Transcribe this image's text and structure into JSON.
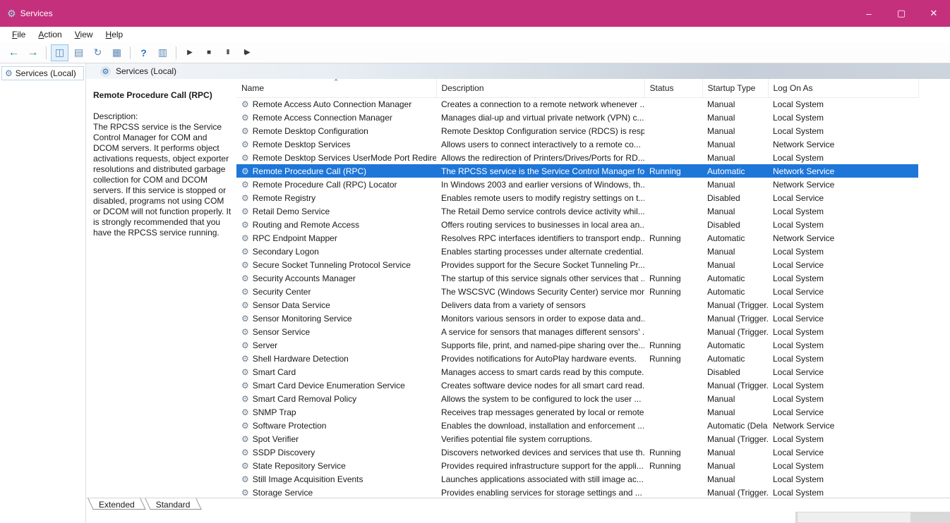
{
  "window": {
    "title": "Services",
    "controls": [
      {
        "name": "minimize",
        "glyph": "–"
      },
      {
        "name": "maximize",
        "glyph": "▢"
      },
      {
        "name": "close",
        "glyph": "✕"
      }
    ]
  },
  "menu": {
    "items": [
      "File",
      "Action",
      "View",
      "Help"
    ]
  },
  "toolbar": {
    "buttons": [
      {
        "name": "back-button",
        "glyph": "←",
        "style": "nav"
      },
      {
        "name": "forward-button",
        "glyph": "→",
        "style": "nav"
      },
      {
        "type": "sep"
      },
      {
        "name": "show-console-tree-button",
        "glyph": "◫",
        "style": "doc",
        "pressed": true
      },
      {
        "name": "properties-button",
        "glyph": "▤",
        "style": "doc"
      },
      {
        "name": "refresh-button",
        "glyph": "↻",
        "style": "doc"
      },
      {
        "name": "export-list-button",
        "glyph": "▦",
        "style": "doc"
      },
      {
        "type": "sep"
      },
      {
        "name": "help-button",
        "glyph": "?",
        "style": "help"
      },
      {
        "name": "show-action-pane-button",
        "glyph": "▥",
        "style": "doc"
      },
      {
        "type": "sep"
      },
      {
        "name": "start-service-button",
        "glyph": "▶",
        "style": "media"
      },
      {
        "name": "stop-service-button",
        "glyph": "■",
        "style": "media"
      },
      {
        "name": "pause-service-button",
        "glyph": "II",
        "style": "media"
      },
      {
        "name": "restart-service-button",
        "glyph": "I▶",
        "style": "media"
      }
    ]
  },
  "tree": {
    "root_label": "Services (Local)"
  },
  "icons": {
    "app": "⚙",
    "tree": "⚙",
    "header": "⚙",
    "service_gear": "⚙"
  },
  "colors": {
    "titlebar": "#c5307d",
    "selection": "#1e76d8"
  },
  "main": {
    "header_title": "Services (Local)",
    "detail": {
      "title": "Remote Procedure Call (RPC)",
      "description_label": "Description:",
      "description_text": "The RPCSS service is the Service Control Manager for COM and DCOM servers. It performs object activations requests, object exporter resolutions and distributed garbage collection for COM and DCOM servers. If this service is stopped or disabled, programs not using COM or DCOM will not function properly. It is strongly recommended that you have the RPCSS service running."
    },
    "table": {
      "columns": [
        "Name",
        "Description",
        "Status",
        "Startup Type",
        "Log On As"
      ],
      "sort_indicator": "^",
      "rows": [
        {
          "name": "Remote Access Auto Connection Manager",
          "description": "Creates a connection to a remote network whenever ...",
          "status": "",
          "startup": "Manual",
          "logon": "Local System",
          "selected": false
        },
        {
          "name": "Remote Access Connection Manager",
          "description": "Manages dial-up and virtual private network (VPN) c...",
          "status": "",
          "startup": "Manual",
          "logon": "Local System",
          "selected": false
        },
        {
          "name": "Remote Desktop Configuration",
          "description": "Remote Desktop Configuration service (RDCS) is resp...",
          "status": "",
          "startup": "Manual",
          "logon": "Local System",
          "selected": false
        },
        {
          "name": "Remote Desktop Services",
          "description": "Allows users to connect interactively to a remote co...",
          "status": "",
          "startup": "Manual",
          "logon": "Network Service",
          "selected": false
        },
        {
          "name": "Remote Desktop Services UserMode Port Redire...",
          "description": "Allows the redirection of Printers/Drives/Ports for RD...",
          "status": "",
          "startup": "Manual",
          "logon": "Local System",
          "selected": false
        },
        {
          "name": "Remote Procedure Call (RPC)",
          "description": "The RPCSS service is the Service Control Manager for...",
          "status": "Running",
          "startup": "Automatic",
          "logon": "Network Service",
          "selected": true
        },
        {
          "name": "Remote Procedure Call (RPC) Locator",
          "description": "In Windows 2003 and earlier versions of Windows, th...",
          "status": "",
          "startup": "Manual",
          "logon": "Network Service",
          "selected": false
        },
        {
          "name": "Remote Registry",
          "description": "Enables remote users to modify registry settings on t...",
          "status": "",
          "startup": "Disabled",
          "logon": "Local Service",
          "selected": false
        },
        {
          "name": "Retail Demo Service",
          "description": "The Retail Demo service controls device activity whil...",
          "status": "",
          "startup": "Manual",
          "logon": "Local System",
          "selected": false
        },
        {
          "name": "Routing and Remote Access",
          "description": "Offers routing services to businesses in local area an...",
          "status": "",
          "startup": "Disabled",
          "logon": "Local System",
          "selected": false
        },
        {
          "name": "RPC Endpoint Mapper",
          "description": "Resolves RPC interfaces identifiers to transport endp...",
          "status": "Running",
          "startup": "Automatic",
          "logon": "Network Service",
          "selected": false
        },
        {
          "name": "Secondary Logon",
          "description": "Enables starting processes under alternate credential...",
          "status": "",
          "startup": "Manual",
          "logon": "Local System",
          "selected": false
        },
        {
          "name": "Secure Socket Tunneling Protocol Service",
          "description": "Provides support for the Secure Socket Tunneling Pr...",
          "status": "",
          "startup": "Manual",
          "logon": "Local Service",
          "selected": false
        },
        {
          "name": "Security Accounts Manager",
          "description": "The startup of this service signals other services that ...",
          "status": "Running",
          "startup": "Automatic",
          "logon": "Local System",
          "selected": false
        },
        {
          "name": "Security Center",
          "description": "The WSCSVC (Windows Security Center) service mon...",
          "status": "Running",
          "startup": "Automatic",
          "logon": "Local Service",
          "selected": false
        },
        {
          "name": "Sensor Data Service",
          "description": "Delivers data from a variety of sensors",
          "status": "",
          "startup": "Manual (Trigger...",
          "logon": "Local System",
          "selected": false
        },
        {
          "name": "Sensor Monitoring Service",
          "description": "Monitors various sensors in order to expose data and...",
          "status": "",
          "startup": "Manual (Trigger...",
          "logon": "Local Service",
          "selected": false
        },
        {
          "name": "Sensor Service",
          "description": "A service for sensors that manages different sensors' ...",
          "status": "",
          "startup": "Manual (Trigger...",
          "logon": "Local System",
          "selected": false
        },
        {
          "name": "Server",
          "description": "Supports file, print, and named-pipe sharing over the...",
          "status": "Running",
          "startup": "Automatic",
          "logon": "Local System",
          "selected": false
        },
        {
          "name": "Shell Hardware Detection",
          "description": "Provides notifications for AutoPlay hardware events.",
          "status": "Running",
          "startup": "Automatic",
          "logon": "Local System",
          "selected": false
        },
        {
          "name": "Smart Card",
          "description": "Manages access to smart cards read by this compute...",
          "status": "",
          "startup": "Disabled",
          "logon": "Local Service",
          "selected": false
        },
        {
          "name": "Smart Card Device Enumeration Service",
          "description": "Creates software device nodes for all smart card read...",
          "status": "",
          "startup": "Manual (Trigger...",
          "logon": "Local System",
          "selected": false
        },
        {
          "name": "Smart Card Removal Policy",
          "description": "Allows the system to be configured to lock the user ...",
          "status": "",
          "startup": "Manual",
          "logon": "Local System",
          "selected": false
        },
        {
          "name": "SNMP Trap",
          "description": "Receives trap messages generated by local or remote...",
          "status": "",
          "startup": "Manual",
          "logon": "Local Service",
          "selected": false
        },
        {
          "name": "Software Protection",
          "description": "Enables the download, installation and enforcement ...",
          "status": "",
          "startup": "Automatic (Dela...",
          "logon": "Network Service",
          "selected": false
        },
        {
          "name": "Spot Verifier",
          "description": "Verifies potential file system corruptions.",
          "status": "",
          "startup": "Manual (Trigger...",
          "logon": "Local System",
          "selected": false
        },
        {
          "name": "SSDP Discovery",
          "description": "Discovers networked devices and services that use th...",
          "status": "Running",
          "startup": "Manual",
          "logon": "Local Service",
          "selected": false
        },
        {
          "name": "State Repository Service",
          "description": "Provides required infrastructure support for the appli...",
          "status": "Running",
          "startup": "Manual",
          "logon": "Local System",
          "selected": false
        },
        {
          "name": "Still Image Acquisition Events",
          "description": "Launches applications associated with still image ac...",
          "status": "",
          "startup": "Manual",
          "logon": "Local System",
          "selected": false
        },
        {
          "name": "Storage Service",
          "description": "Provides enabling services for storage settings and ...",
          "status": "",
          "startup": "Manual (Trigger...",
          "logon": "Local System",
          "selected": false
        }
      ]
    },
    "tabs": [
      {
        "label": "Extended",
        "active": true
      },
      {
        "label": "Standard",
        "active": false
      }
    ]
  }
}
